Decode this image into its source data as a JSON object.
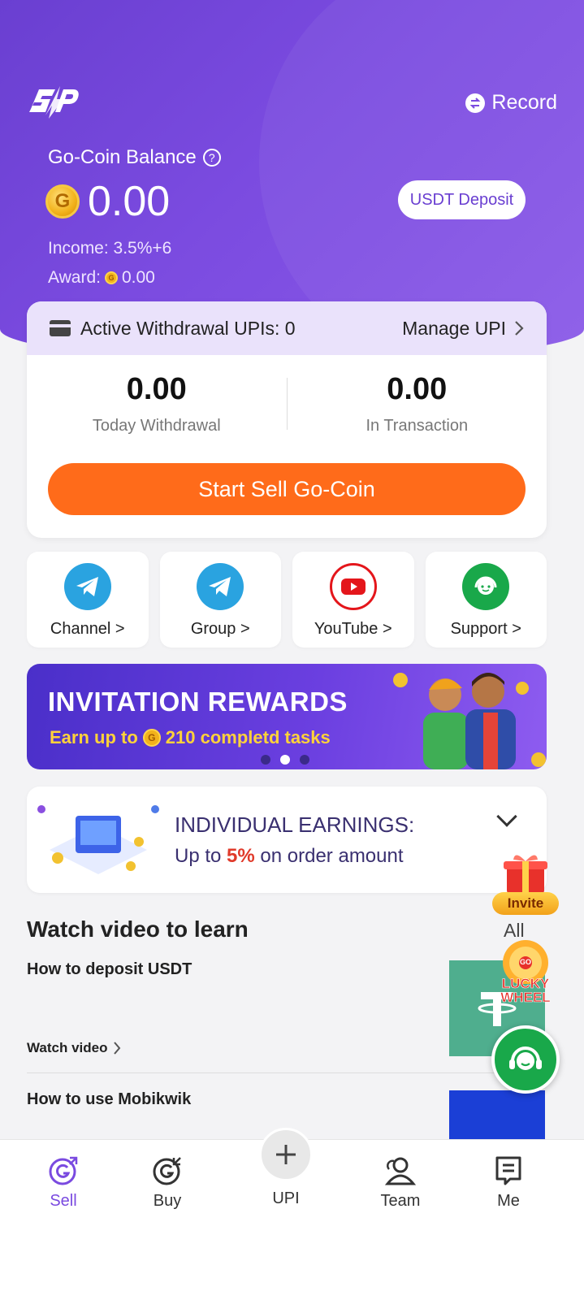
{
  "header": {
    "record_label": "Record"
  },
  "balance": {
    "label": "Go-Coin Balance",
    "value": "0.00",
    "deposit_button": "USDT Deposit",
    "income": "Income: 3.5%+6",
    "award_label": "Award:",
    "award_value": "0.00"
  },
  "withdrawal_card": {
    "active_upis": "Active Withdrawal UPIs: 0",
    "manage_upi": "Manage UPI",
    "today_value": "0.00",
    "today_label": "Today Withdrawal",
    "transaction_value": "0.00",
    "transaction_label": "In Transaction",
    "sell_button": "Start Sell Go-Coin"
  },
  "tiles": [
    {
      "label": "Channel >",
      "icon": "telegram-icon"
    },
    {
      "label": "Group >",
      "icon": "telegram-icon"
    },
    {
      "label": "YouTube >",
      "icon": "youtube-icon"
    },
    {
      "label": "Support >",
      "icon": "headset-icon"
    }
  ],
  "banner": {
    "title": "INVITATION REWARDS",
    "subtitle_prefix": "Earn up to",
    "subtitle_suffix": "210 completd tasks"
  },
  "earnings": {
    "title": "INDIVIDUAL EARNINGS:",
    "line_prefix": "Up to",
    "line_highlight": "5%",
    "line_suffix": "on order amount"
  },
  "learn": {
    "title": "Watch video to learn",
    "all_label": "All",
    "videos": [
      {
        "title": "How to deposit USDT",
        "watch_label": "Watch video"
      },
      {
        "title": "How to use Mobikwik"
      }
    ]
  },
  "floating": {
    "invite_label": "Invite",
    "wheel_top": "GO",
    "wheel_label_1": "LUCKY",
    "wheel_label_2": "WHEEL"
  },
  "nav": {
    "items": [
      {
        "label": "Sell",
        "active": true
      },
      {
        "label": "Buy"
      },
      {
        "label": "UPI"
      },
      {
        "label": "Team"
      },
      {
        "label": "Me"
      }
    ]
  },
  "colors": {
    "primary_purple": "#7b4be0",
    "sell_orange": "#ff6b1a",
    "support_green": "#19a84a",
    "highlight_red": "#e03a2a"
  }
}
